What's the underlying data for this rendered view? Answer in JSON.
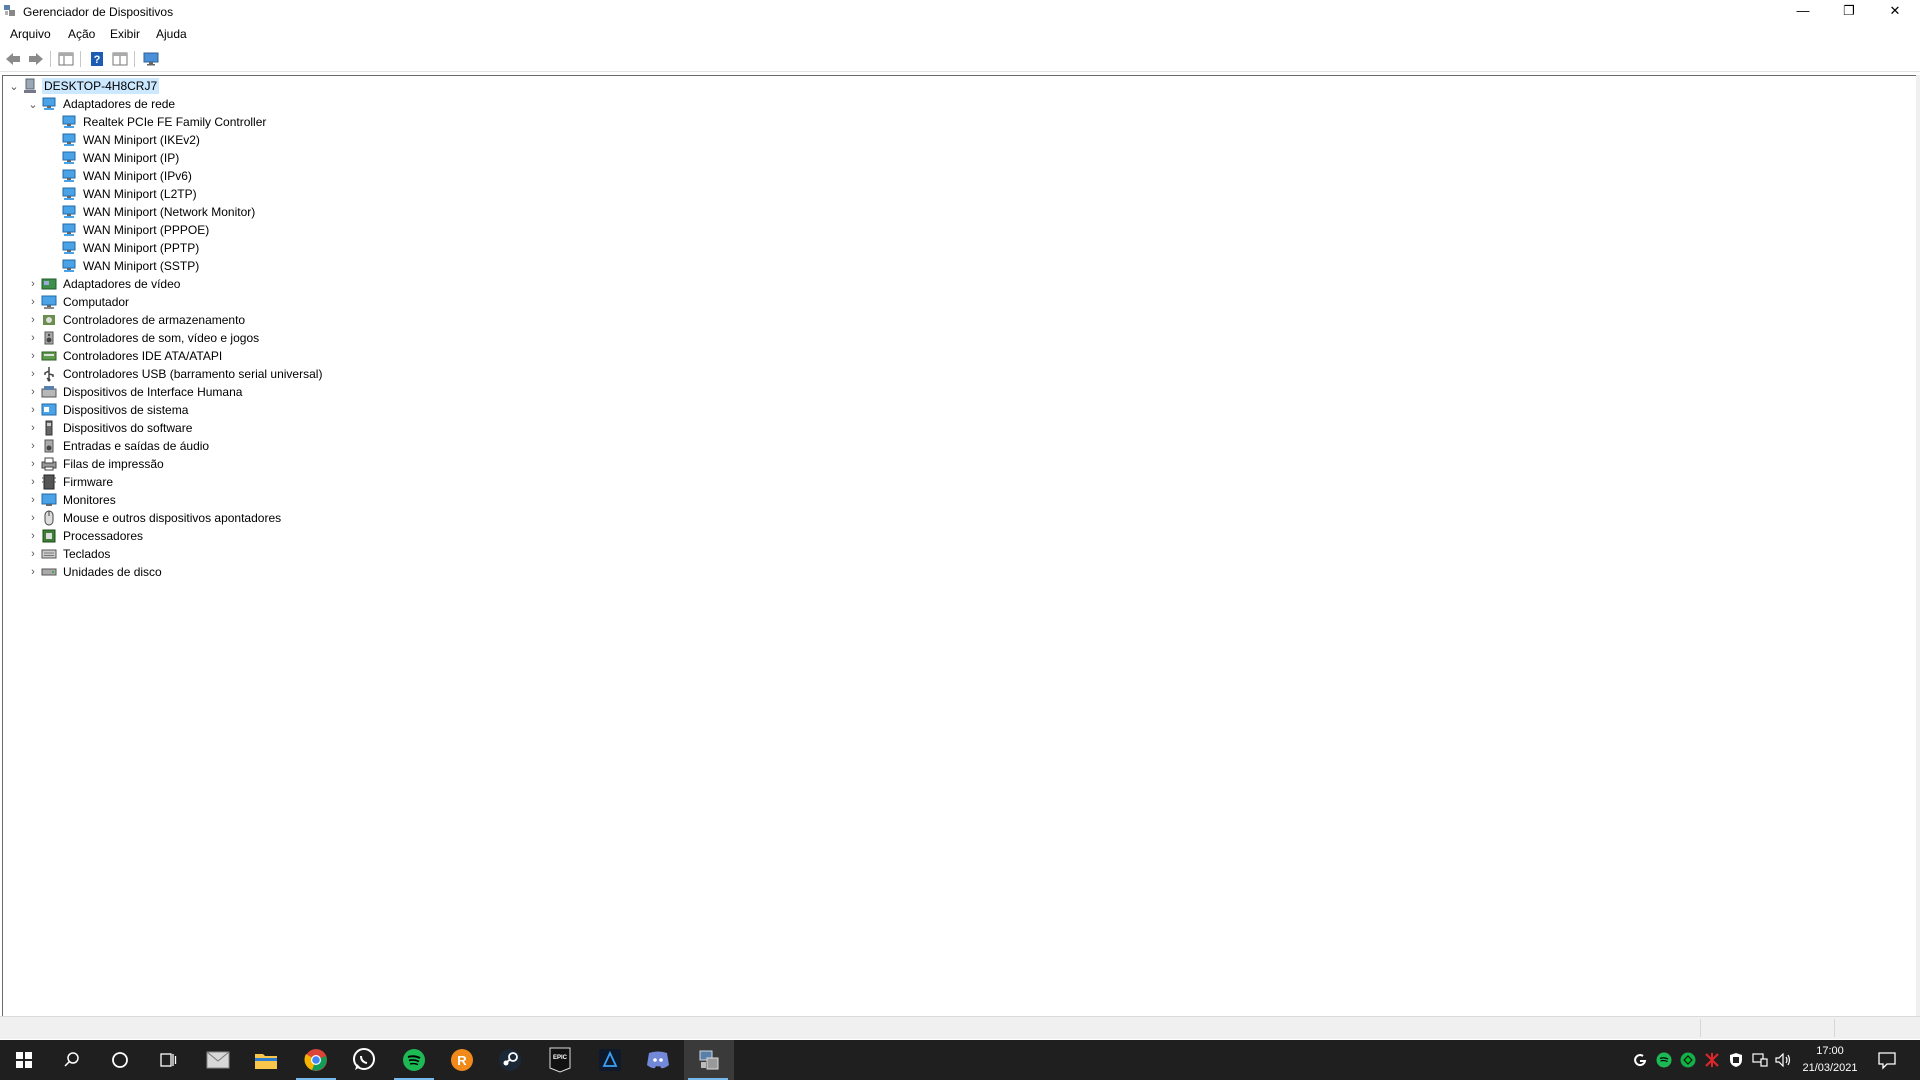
{
  "window": {
    "title": "Gerenciador de Dispositivos",
    "controls": {
      "minimize": "—",
      "maximize": "❐",
      "close": "✕"
    }
  },
  "menu": [
    "Arquivo",
    "Ação",
    "Exibir",
    "Ajuda"
  ],
  "toolbar": [
    "back-icon",
    "forward-icon",
    "properties-view-icon",
    "help-icon",
    "details-view-icon",
    "monitor-scan-icon"
  ],
  "tree": {
    "root": "DESKTOP-4H8CRJ7",
    "expanded_category": "Adaptadores de rede",
    "network_adapters": [
      "Realtek PCIe FE Family Controller",
      "WAN Miniport (IKEv2)",
      "WAN Miniport (IP)",
      "WAN Miniport (IPv6)",
      "WAN Miniport (L2TP)",
      "WAN Miniport (Network Monitor)",
      "WAN Miniport (PPPOE)",
      "WAN Miniport (PPTP)",
      "WAN Miniport (SSTP)"
    ],
    "categories": [
      {
        "label": "Adaptadores de vídeo",
        "icon": "display-adapter-icon"
      },
      {
        "label": "Computador",
        "icon": "computer-icon"
      },
      {
        "label": "Controladores de armazenamento",
        "icon": "storage-controller-icon"
      },
      {
        "label": "Controladores de som, vídeo e jogos",
        "icon": "sound-icon"
      },
      {
        "label": "Controladores IDE ATA/ATAPI",
        "icon": "ide-icon"
      },
      {
        "label": "Controladores USB (barramento serial universal)",
        "icon": "usb-icon"
      },
      {
        "label": "Dispositivos de Interface Humana",
        "icon": "hid-icon"
      },
      {
        "label": "Dispositivos de sistema",
        "icon": "system-device-icon"
      },
      {
        "label": "Dispositivos do software",
        "icon": "software-device-icon"
      },
      {
        "label": "Entradas e saídas de áudio",
        "icon": "audio-io-icon"
      },
      {
        "label": "Filas de impressão",
        "icon": "printer-icon"
      },
      {
        "label": "Firmware",
        "icon": "firmware-icon"
      },
      {
        "label": "Monitores",
        "icon": "monitor-icon"
      },
      {
        "label": "Mouse e outros dispositivos apontadores",
        "icon": "mouse-icon"
      },
      {
        "label": "Processadores",
        "icon": "processor-icon"
      },
      {
        "label": "Teclados",
        "icon": "keyboard-icon"
      },
      {
        "label": "Unidades de disco",
        "icon": "disk-drive-icon"
      }
    ]
  },
  "taskbar": {
    "apps": [
      "start-icon",
      "search-icon",
      "cortana-icon",
      "task-view-icon",
      "mail-icon",
      "file-explorer-icon",
      "chrome-icon",
      "whatsapp-icon",
      "spotify-icon",
      "rockstar-icon",
      "steam-icon",
      "epic-games-icon",
      "battlenet-icon",
      "discord-icon",
      "device-manager-icon"
    ],
    "epic_label": "EPIC",
    "clock_time": "17:00",
    "clock_date": "21/03/2021"
  },
  "colors": {
    "selection": "#cce8ff",
    "network_icon": "#2b88d8",
    "taskbar": "#1f1f1f",
    "taskbar_indicator": "#76b9ed"
  }
}
